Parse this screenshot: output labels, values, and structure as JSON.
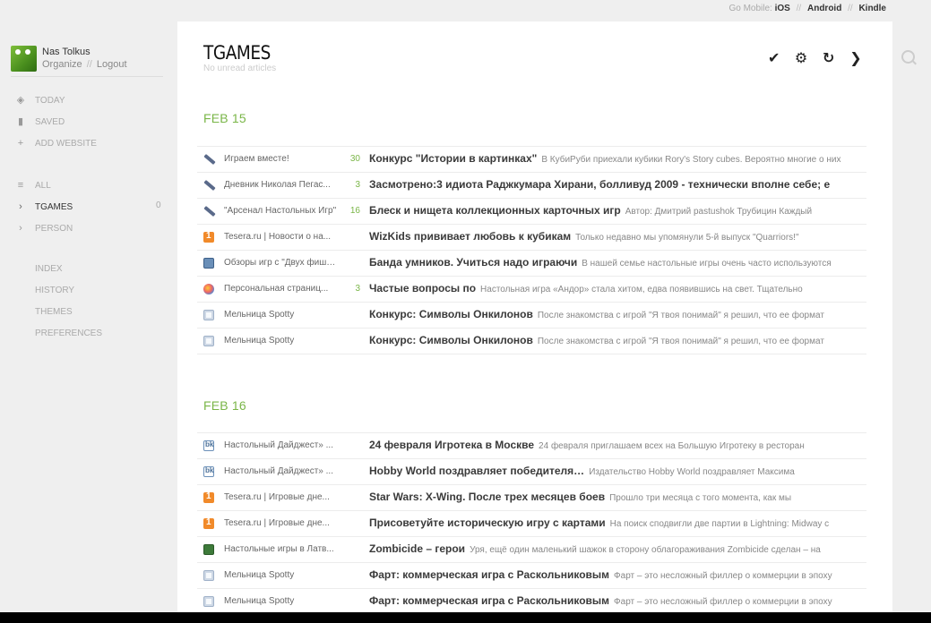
{
  "mobile": {
    "prefix": "Go Mobile:",
    "ios": "iOS",
    "android": "Android",
    "kindle": "Kindle",
    "sep": "//"
  },
  "user": {
    "name": "Nas Tolkus",
    "organize": "Organize",
    "sep": "//",
    "logout": "Logout"
  },
  "nav": {
    "today": "TODAY",
    "saved": "SAVED",
    "add": "ADD WEBSITE",
    "all": "ALL",
    "tgames": "TGAMES",
    "tgames_count": "0",
    "person": "PERSON",
    "index": "INDEX",
    "history": "HISTORY",
    "themes": "THEMES",
    "preferences": "PREFERENCES"
  },
  "header": {
    "title": "TGAMES",
    "subtitle": "No unread articles"
  },
  "tools": {
    "check": "✔",
    "gear": "⚙",
    "refresh": "↻",
    "next": "❯"
  },
  "sections": [
    {
      "date": "FEB 15",
      "rows": [
        {
          "icon": "pen-icon",
          "feed": "Играем вместе!",
          "count": "30",
          "title": "Конкурс \"Истории в картинках\"",
          "snippet": "В КубиРуби приехали кубики Rory's Story cubes. Вероятно многие о них"
        },
        {
          "icon": "pen-icon",
          "feed": "Дневник Николая Пегас...",
          "count": "3",
          "title": "Засмотрено:3 идиота Раджкумара Хирани, болливуд 2009 - технически вполне себе; е",
          "snippet": ""
        },
        {
          "icon": "pen-icon",
          "feed": "\"Арсенал Настольных Игр\"",
          "count": "16",
          "title": "Блеск и нищета коллекционных карточных игр",
          "snippet": "Автор: Дмитрий pastushok Трубицин Каждый"
        },
        {
          "icon": "orange-icon",
          "feed": "Tesera.ru | Новости о на...",
          "count": "",
          "title": "WizKids прививает любовь к кубикам",
          "snippet": "Только недавно мы упомянули 5-й выпуск \"Quarriors!\""
        },
        {
          "icon": "blue-icon",
          "feed": "Обзоры игр с \"Двух фишек\"",
          "count": "",
          "title": "Банда умников. Учиться надо играючи",
          "snippet": "В нашей семье настольные игры очень часто используются"
        },
        {
          "icon": "globe-icon",
          "feed": "Персональная страниц...",
          "count": "3",
          "title": "Частые вопросы по",
          "snippet": "Настольная игра «Андор» стала хитом, едва появившись на свет. Тщательно"
        },
        {
          "icon": "rss-icon",
          "feed": "Мельница Spotty",
          "count": "",
          "title": "Конкурс: Символы Онкилонов",
          "snippet": "После знакомства с игрой \"Я твоя понимай\" я решил, что ее формат"
        },
        {
          "icon": "rss-icon",
          "feed": "Мельница Spotty",
          "count": "",
          "title": "Конкурс: Символы Онкилонов",
          "snippet": "После знакомства с игрой \"Я твоя понимай\" я решил, что ее формат"
        }
      ]
    },
    {
      "date": "FEB 16",
      "rows": [
        {
          "icon": "bk-icon",
          "feed": "Настольный Дайджест» ...",
          "count": "",
          "title": "24 февраля Игротека в Москве",
          "snippet": "24 февраля приглашаем всех на Большую Игротеку в ресторан"
        },
        {
          "icon": "bk-icon",
          "feed": "Настольный Дайджест» ...",
          "count": "",
          "title": "Hobby World поздравляет победителя…",
          "snippet": "Издательство Hobby World поздравляет Максима"
        },
        {
          "icon": "orange-icon",
          "feed": "Tesera.ru | Игровые дне...",
          "count": "",
          "title": "Star Wars: X-Wing. После трех месяцев боев",
          "snippet": "Прошло три месяца с того момента, как мы"
        },
        {
          "icon": "orange-icon",
          "feed": "Tesera.ru | Игровые дне...",
          "count": "",
          "title": "Присоветуйте историческую игру с картами",
          "snippet": "На поиск сподвигли две партии в Lightning: Midway с"
        },
        {
          "icon": "green-icon",
          "feed": "Настольные игры в Латв...",
          "count": "",
          "title": "Zombicide – герои",
          "snippet": "Уря, ещё один маленький шажок в сторону облагораживания Zombicide сделан – на"
        },
        {
          "icon": "rss-icon",
          "feed": "Мельница Spotty",
          "count": "",
          "title": "Фарт: коммерческая игра с Раскольниковым",
          "snippet": "Фарт – это несложный филлер о коммерции в эпоху"
        },
        {
          "icon": "rss-icon",
          "feed": "Мельница Spotty",
          "count": "",
          "title": "Фарт: коммерческая игра с Раскольниковым",
          "snippet": "Фарт – это несложный филлер о коммерции в эпоху"
        }
      ]
    }
  ]
}
